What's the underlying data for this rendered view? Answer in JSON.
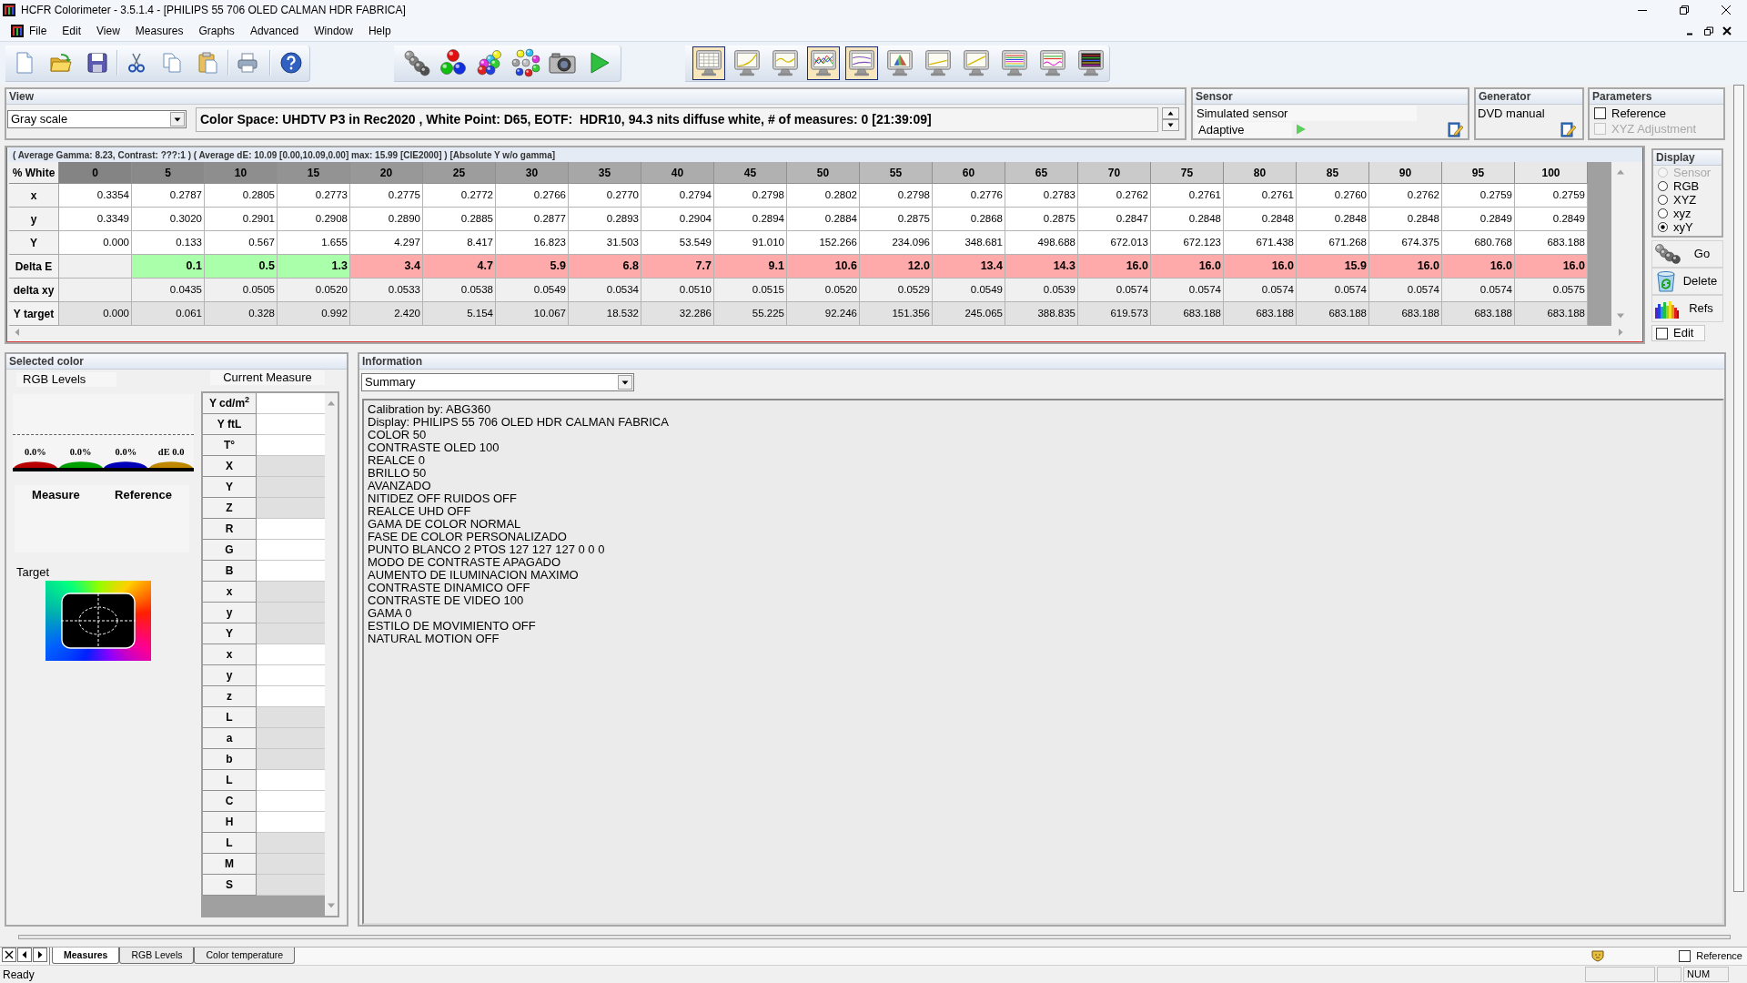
{
  "window": {
    "title": "HCFR Colorimeter - 3.5.1.4 - [PHILIPS 55 706 OLED CALMAN HDR FABRICA]"
  },
  "menu": [
    "File",
    "Edit",
    "View",
    "Measures",
    "Graphs",
    "Advanced",
    "Window",
    "Help"
  ],
  "view_toolbar": [
    {
      "selected": true
    },
    {
      "selected": false
    },
    {
      "selected": false
    },
    {
      "selected": true
    },
    {
      "selected": true
    },
    {
      "selected": false
    },
    {
      "selected": false
    },
    {
      "selected": false
    },
    {
      "selected": false
    },
    {
      "selected": false
    },
    {
      "selected": false
    }
  ],
  "view_panel": {
    "title": "View",
    "mode": "Gray scale",
    "info": "Color Space: UHDTV P3 in Rec2020 , White Point: D65, EOTF:  HDR10, 94.3 nits diffuse white, # of measures: 0 [21:39:09]"
  },
  "sensor_panel": {
    "title": "Sensor",
    "name": "Simulated sensor",
    "mode": "Adaptive"
  },
  "generator_panel": {
    "title": "Generator",
    "name": "DVD manual"
  },
  "parameters_panel": {
    "title": "Parameters",
    "options": [
      {
        "label": "Reference",
        "checked": false,
        "disabled": false
      },
      {
        "label": "XYZ Adjustment",
        "checked": false,
        "disabled": true
      }
    ]
  },
  "table": {
    "summary": "( Average Gamma: 8.23, Contrast: ???:1 ) ( Average dE: 10.09 [0.00,10.09,0.00] max: 15.99 [CIE2000] ) [Absolute Y w/o gamma]",
    "corner": "% White",
    "columns": [
      {
        "label": "0",
        "color": "#848484"
      },
      {
        "label": "5",
        "color": "#898989"
      },
      {
        "label": "10",
        "color": "#8e8e8e"
      },
      {
        "label": "15",
        "color": "#939393"
      },
      {
        "label": "20",
        "color": "#989898"
      },
      {
        "label": "25",
        "color": "#9d9d9d"
      },
      {
        "label": "30",
        "color": "#a2a2a2"
      },
      {
        "label": "35",
        "color": "#a7a7a7"
      },
      {
        "label": "40",
        "color": "#acacac"
      },
      {
        "label": "45",
        "color": "#b1b1b1"
      },
      {
        "label": "50",
        "color": "#b6b6b6"
      },
      {
        "label": "55",
        "color": "#bbbbbb"
      },
      {
        "label": "60",
        "color": "#c0c0c0"
      },
      {
        "label": "65",
        "color": "#c5c5c5"
      },
      {
        "label": "70",
        "color": "#cacaca"
      },
      {
        "label": "75",
        "color": "#cfcfcf"
      },
      {
        "label": "80",
        "color": "#d4d4d4"
      },
      {
        "label": "85",
        "color": "#d9d9d9"
      },
      {
        "label": "90",
        "color": "#dedede"
      },
      {
        "label": "95",
        "color": "#e3e3e3"
      },
      {
        "label": "100",
        "color": "#e8e8e8"
      }
    ],
    "rows": [
      {
        "label": "x",
        "kind": "value",
        "cells": [
          "0.3354",
          "0.2787",
          "0.2805",
          "0.2773",
          "0.2775",
          "0.2772",
          "0.2766",
          "0.2770",
          "0.2794",
          "0.2798",
          "0.2802",
          "0.2798",
          "0.2776",
          "0.2783",
          "0.2762",
          "0.2761",
          "0.2761",
          "0.2760",
          "0.2762",
          "0.2759",
          "0.2759"
        ]
      },
      {
        "label": "y",
        "kind": "value",
        "cells": [
          "0.3349",
          "0.3020",
          "0.2901",
          "0.2908",
          "0.2890",
          "0.2885",
          "0.2877",
          "0.2893",
          "0.2904",
          "0.2894",
          "0.2884",
          "0.2875",
          "0.2868",
          "0.2875",
          "0.2847",
          "0.2848",
          "0.2848",
          "0.2848",
          "0.2848",
          "0.2849",
          "0.2849"
        ]
      },
      {
        "label": "Y",
        "kind": "value",
        "cells": [
          "0.000",
          "0.133",
          "0.567",
          "1.655",
          "4.297",
          "8.417",
          "16.823",
          "31.503",
          "53.549",
          "91.010",
          "152.266",
          "234.096",
          "348.681",
          "498.688",
          "672.013",
          "672.123",
          "671.438",
          "671.268",
          "674.375",
          "680.768",
          "683.188"
        ]
      },
      {
        "label": "Delta E",
        "kind": "delta",
        "cells": [
          null,
          {
            "value": "0.1",
            "color": "#aaffaa"
          },
          {
            "value": "0.5",
            "color": "#aaffaa"
          },
          {
            "value": "1.3",
            "color": "#aaffaa"
          },
          {
            "value": "3.4",
            "color": "#ffaaaa"
          },
          {
            "value": "4.7",
            "color": "#ffaaaa"
          },
          {
            "value": "5.9",
            "color": "#ffaaaa"
          },
          {
            "value": "6.8",
            "color": "#ffaaaa"
          },
          {
            "value": "7.7",
            "color": "#ffaaaa"
          },
          {
            "value": "9.1",
            "color": "#ffaaaa"
          },
          {
            "value": "10.6",
            "color": "#ffaaaa"
          },
          {
            "value": "12.0",
            "color": "#ffaaaa"
          },
          {
            "value": "13.4",
            "color": "#ffaaaa"
          },
          {
            "value": "14.3",
            "color": "#ffaaaa"
          },
          {
            "value": "16.0",
            "color": "#ffaaaa"
          },
          {
            "value": "16.0",
            "color": "#ffaaaa"
          },
          {
            "value": "16.0",
            "color": "#ffaaaa"
          },
          {
            "value": "15.9",
            "color": "#ffaaaa"
          },
          {
            "value": "16.0",
            "color": "#ffaaaa"
          },
          {
            "value": "16.0",
            "color": "#ffaaaa"
          },
          {
            "value": "16.0",
            "color": "#ffaaaa"
          }
        ]
      },
      {
        "label": "delta xy",
        "kind": "value",
        "cells": [
          null,
          "0.0435",
          "0.0505",
          "0.0520",
          "0.0533",
          "0.0538",
          "0.0549",
          "0.0534",
          "0.0510",
          "0.0515",
          "0.0520",
          "0.0529",
          "0.0549",
          "0.0539",
          "0.0574",
          "0.0574",
          "0.0574",
          "0.0574",
          "0.0574",
          "0.0574",
          "0.0575"
        ]
      },
      {
        "label": "Y target",
        "kind": "value",
        "cells": [
          "0.000",
          "0.061",
          "0.328",
          "0.992",
          "2.420",
          "5.154",
          "10.067",
          "18.532",
          "32.286",
          "55.225",
          "92.246",
          "151.356",
          "245.065",
          "388.835",
          "619.573",
          "683.188",
          "683.188",
          "683.188",
          "683.188",
          "683.188",
          "683.188"
        ]
      }
    ]
  },
  "display_panel": {
    "title": "Display",
    "options": [
      {
        "label": "Sensor",
        "selected": false,
        "disabled": true
      },
      {
        "label": "RGB",
        "selected": false,
        "disabled": false
      },
      {
        "label": "XYZ",
        "selected": false,
        "disabled": false
      },
      {
        "label": "xyz",
        "selected": false,
        "disabled": false
      },
      {
        "label": "xyY",
        "selected": true,
        "disabled": false
      }
    ],
    "buttons": [
      "Go",
      "Delete",
      "Refs"
    ],
    "edit": {
      "label": "Edit",
      "checked": false
    }
  },
  "selected_color": {
    "title": "Selected color",
    "rgb_levels_label": "RGB Levels",
    "current_measure_label": "Current Measure",
    "levels": [
      {
        "reading": "0.0%",
        "color": "#b80000"
      },
      {
        "reading": "0.0%",
        "color": "#00a000"
      },
      {
        "reading": "0.0%",
        "color": "#0000b8"
      },
      {
        "reading": "dE 0.0",
        "color": "#c08800"
      }
    ],
    "measure_label": "Measure",
    "reference_label": "Reference",
    "target_label": "Target",
    "measures": [
      "Y cd/m$^{2}$",
      "Y ftL",
      "T°",
      "X",
      "Y",
      "Z",
      "R",
      "G",
      "B",
      "x",
      "y",
      "Y",
      "x",
      "y",
      "z",
      "L",
      "a",
      "b",
      "L",
      "C",
      "H",
      "L",
      "M",
      "S"
    ]
  },
  "information": {
    "title": "Information",
    "view": "Summary",
    "lines": [
      "Calibration by: ABG360",
      "Display: PHILIPS 55 706 OLED HDR CALMAN FABRICA",
      "COLOR 50",
      "CONTRASTE OLED 100",
      "REALCE 0",
      "BRILLO 50",
      "AVANZADO",
      "NITIDEZ OFF RUIDOS OFF",
      "REALCE UHD OFF",
      "GAMA DE COLOR NORMAL",
      "FASE DE COLOR PERSONALIZADO",
      "PUNTO BLANCO 2 PTOS 127 127 127 0 0 0",
      "MODO DE CONTRASTE APAGADO",
      "AUMENTO DE ILUMINACION MAXIMO",
      "CONTRASTE DINAMICO OFF",
      "CONTRASTE DE VIDEO 100",
      "GAMA 0",
      "ESTILO DE MOVIMIENTO OFF",
      "NATURAL MOTION OFF"
    ]
  },
  "tabs": [
    {
      "label": "Measures",
      "selected": true
    },
    {
      "label": "RGB Levels",
      "selected": false
    },
    {
      "label": "Color temperature",
      "selected": false
    }
  ],
  "reference_toggle": {
    "label": "Reference",
    "checked": false
  },
  "status_bar": {
    "message": "Ready",
    "num": "NUM"
  }
}
